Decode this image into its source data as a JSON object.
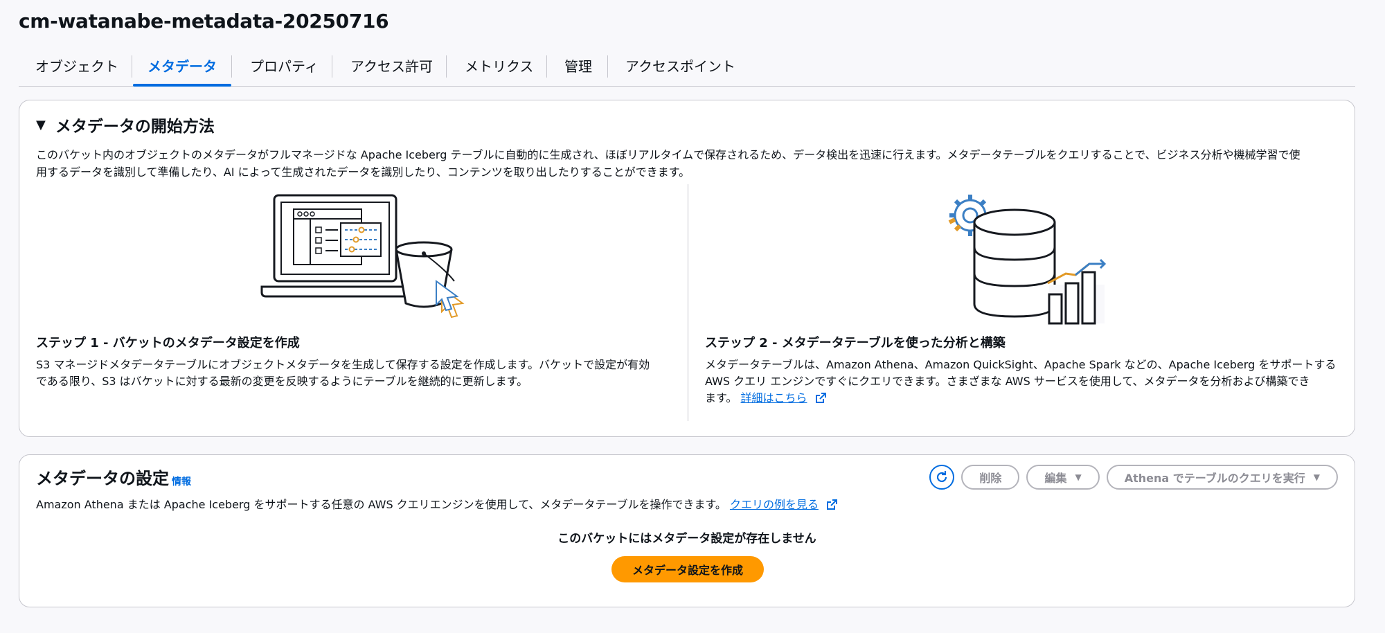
{
  "page": {
    "title": "cm-watanabe-metadata-20250716"
  },
  "tabs": [
    {
      "label": "オブジェクト"
    },
    {
      "label": "メタデータ"
    },
    {
      "label": "プロパティ"
    },
    {
      "label": "アクセス許可"
    },
    {
      "label": "メトリクス"
    },
    {
      "label": "管理"
    },
    {
      "label": "アクセスポイント"
    }
  ],
  "active_tab": "メタデータ",
  "getting_started": {
    "heading": "メタデータの開始方法",
    "description_line1": "このバケット内のオブジェクトのメタデータがフルマネージドな Apache Iceberg テーブルに自動的に生成され、ほぼリアルタイムで保存されるため、データ検出を迅速に行えます。メタデータテーブルをクエリすることで、ビジネス分析や機械学習で使",
    "description_line2": "用するデータを識別して準備したり、AI によって生成されたデータを識別したり、コンテンツを取り出したりすることができます。",
    "step1": {
      "title": "ステップ 1 - バケットのメタデータ設定を作成",
      "body_line1": "S3 マネージドメタデータテーブルにオブジェクトメタデータを生成して保存する設定を作成します。バケットで設定が有効",
      "body_line2": "である限り、S3 はバケットに対する最新の変更を反映するようにテーブルを継続的に更新します。"
    },
    "step2": {
      "title": "ステップ 2 - メタデータテーブルを使った分析と構築",
      "body_line1": "メタデータテーブルは、Amazon Athena、Amazon QuickSight、Apache Spark などの、Apache Iceberg をサポートする",
      "body_line2": "AWS クエリ エンジンですぐにクエリできます。さまざまな AWS サービスを使用して、メタデータを分析および構築でき",
      "body_line3": "ます。",
      "link": "詳細はこちら"
    }
  },
  "metadata_config": {
    "title": "メタデータの設定",
    "info": "情報",
    "description": "Amazon Athena または Apache Iceberg をサポートする任意の AWS クエリエンジンを使用して、メタデータテーブルを操作できます。",
    "example_link": "クエリの例を見る",
    "buttons": {
      "delete": "削除",
      "edit": "編集",
      "athena": "Athena でテーブルのクエリを実行"
    },
    "empty_message": "このバケットにはメタデータ設定が存在しません",
    "create_button": "メタデータ設定を作成"
  },
  "colors": {
    "accent": "#006ce0",
    "primary_button": "#ff9900",
    "illustration_orange": "#e29a27",
    "illustration_blue": "#3b7fc4"
  },
  "icons": [
    "caret-down-icon",
    "refresh-icon",
    "external-link-icon",
    "laptop-bucket-illustration",
    "database-chart-illustration"
  ]
}
